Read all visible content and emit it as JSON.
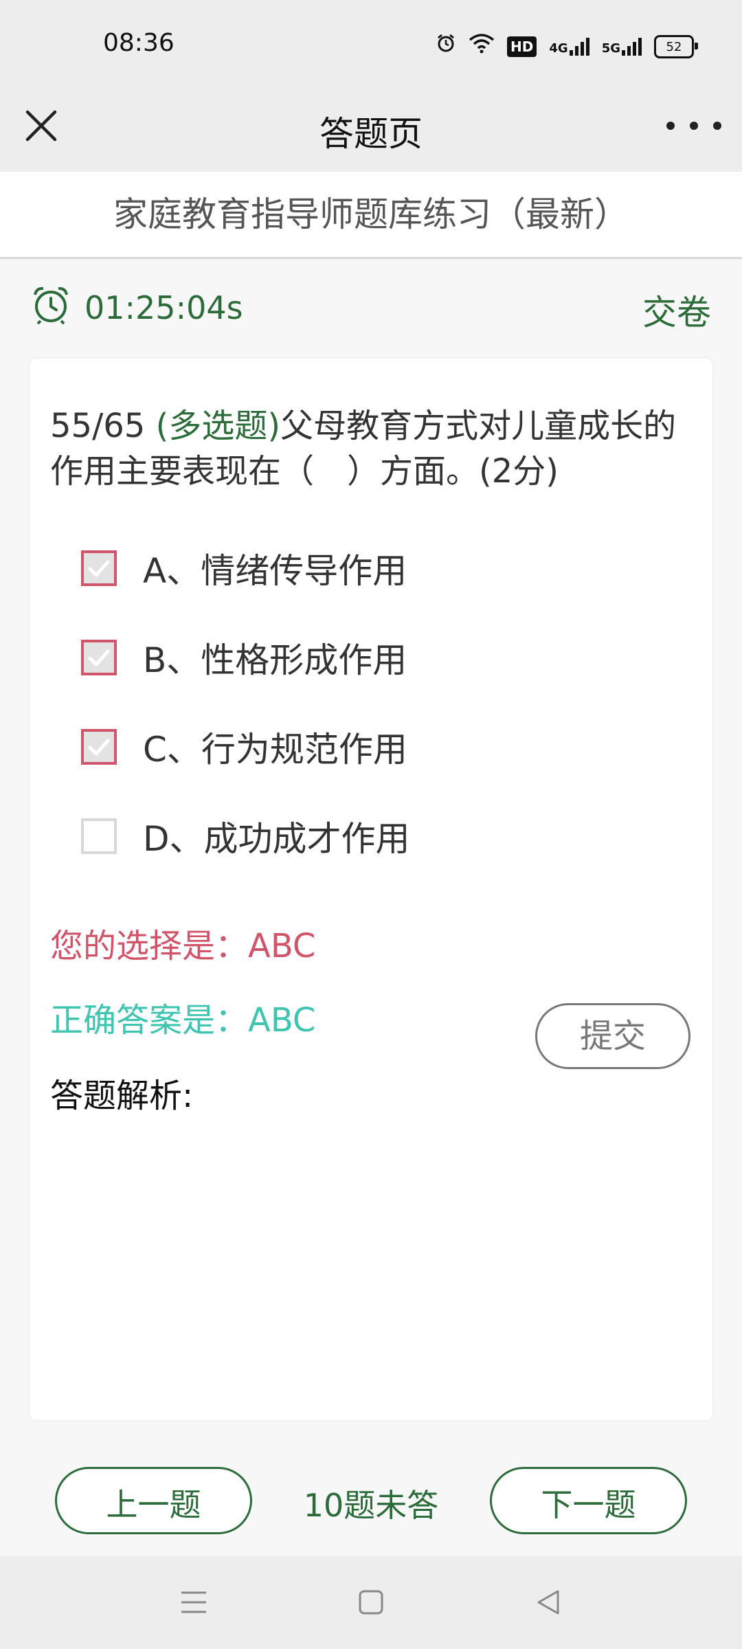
{
  "status_bar": {
    "time": "08:36",
    "hd_badge": "HD",
    "network1": "4G",
    "network2": "5G",
    "battery": "52"
  },
  "title_bar": {
    "title": "答题页"
  },
  "quiz": {
    "title": "家庭教育指导师题库练习（最新）",
    "timer": "01:25:04s",
    "submit_paper": "交卷"
  },
  "question": {
    "number": "55/65",
    "type": "(多选题)",
    "text": "父母教育方式对儿童成长的作用主要表现在（　）方面。(2分)",
    "options": [
      {
        "label": "A、情绪传导作用",
        "checked": true
      },
      {
        "label": "B、性格形成作用",
        "checked": true
      },
      {
        "label": "C、行为规范作用",
        "checked": true
      },
      {
        "label": "D、成功成才作用",
        "checked": false
      }
    ]
  },
  "result": {
    "your_choice": "您的选择是：ABC",
    "correct_answer": "正确答案是：ABC",
    "analysis_label": "答题解析:",
    "submit": "提交"
  },
  "bottom_nav": {
    "prev": "上一题",
    "unanswered": "10题未答",
    "next": "下一题"
  },
  "colors": {
    "accent_green": "#2c6b3a",
    "checked_border": "#d0546a",
    "your_choice": "#d0546a",
    "correct_answer": "#3fc4b0"
  }
}
